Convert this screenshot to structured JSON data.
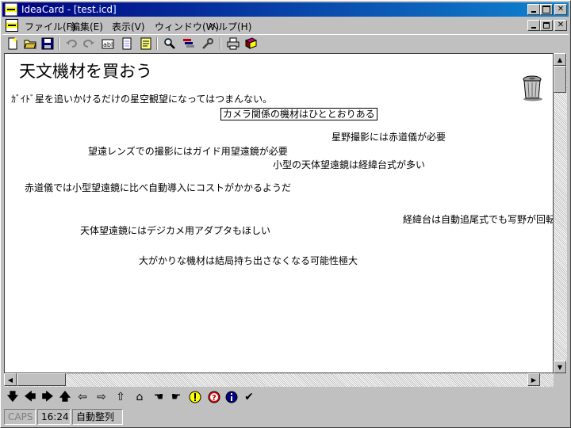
{
  "window": {
    "title": "IdeaCard - [test.icd]"
  },
  "menu": {
    "items": [
      "ファイル(F)",
      "編集(E)",
      "表示(V)",
      "ウィンドウ(W)",
      "ヘルプ(H)"
    ]
  },
  "toolbar": {
    "icons": [
      "new-file-icon",
      "open-folder-icon",
      "save-icon",
      "undo-icon",
      "redo-icon",
      "text-card-icon",
      "blank-card-icon",
      "note-card-icon",
      "search-icon",
      "filter-icon",
      "tools-icon",
      "print-icon",
      "book-icon"
    ]
  },
  "page": {
    "title": "天文機材を買おう"
  },
  "cards": [
    {
      "text": "ｶﾞｲﾄﾞ星を追いかけるだけの星空観望になってはつまんない。"
    },
    {
      "text": "カメラ関係の機材はひととおりある",
      "selected": true
    },
    {
      "text": "星野撮影には赤道儀が必要"
    },
    {
      "text": "望遠レンズでの撮影にはガイド用望遠鏡が必要"
    },
    {
      "text": "小型の天体望遠鏡は経緯台式が多い"
    },
    {
      "text": "赤道儀では小型望遠鏡に比べ自動導入にコストがかかるようだ"
    },
    {
      "text": "経緯台は自動追尾式でも写野が回転"
    },
    {
      "text": "天体望遠鏡にはデジカメ用アダプタもほしい"
    },
    {
      "text": "大がかりな機材は結局持ち出さなくなる可能性極大"
    }
  ],
  "navbar": {
    "icons": [
      "arrow-down-icon",
      "arrow-left-icon",
      "arrow-right-icon",
      "arrow-up-icon",
      "outline-left-icon",
      "outline-right-icon",
      "outline-up-icon",
      "outline-home-icon",
      "hand-left-icon",
      "hand-right-icon",
      "warning-icon",
      "question-icon",
      "info-icon",
      "check-icon"
    ]
  },
  "status": {
    "caps": "CAPS",
    "time": "16:24",
    "mode": "自動整列"
  }
}
